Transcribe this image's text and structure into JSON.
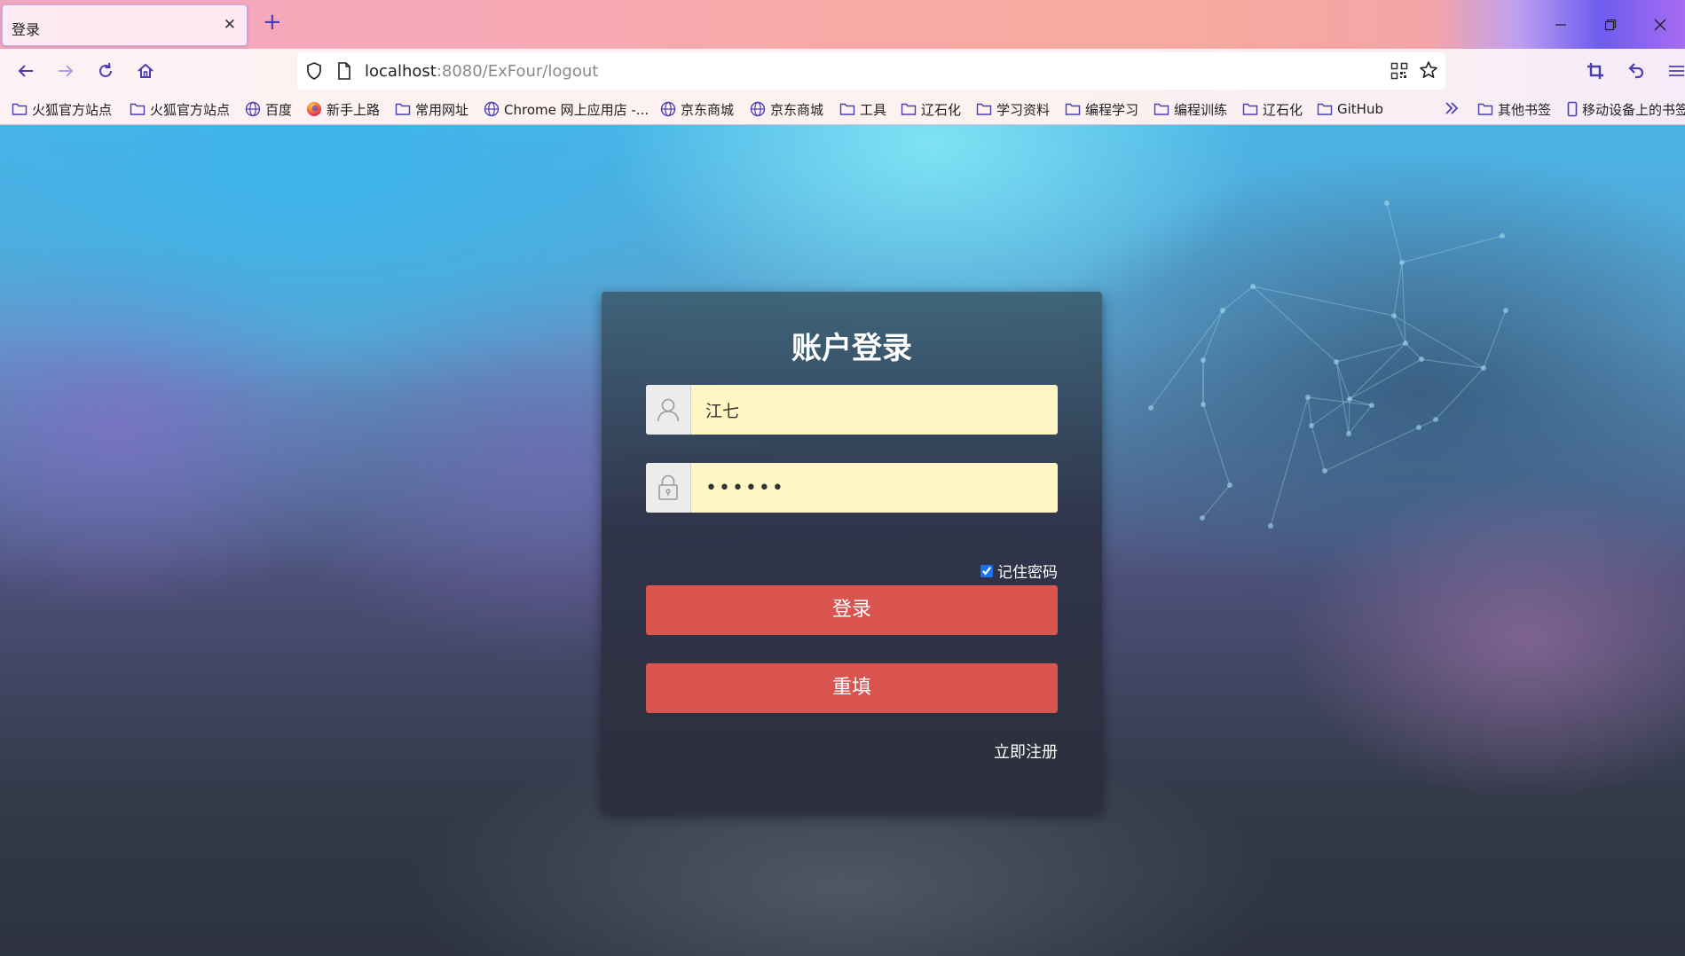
{
  "browser": {
    "tab": {
      "title": "登录"
    },
    "url": {
      "host": "localhost",
      "rest": ":8080/ExFour/logout"
    },
    "bookmarks": [
      {
        "label": "火狐官方站点",
        "icon": "folder-icon"
      },
      {
        "label": "火狐官方站点",
        "icon": "folder-icon"
      },
      {
        "label": "百度",
        "icon": "globe-icon"
      },
      {
        "label": "新手上路",
        "icon": "firefox-icon"
      },
      {
        "label": "常用网址",
        "icon": "folder-icon"
      },
      {
        "label": "Chrome 网上应用店 -...",
        "icon": "globe-icon"
      },
      {
        "label": "京东商城",
        "icon": "globe-icon"
      },
      {
        "label": "京东商城",
        "icon": "globe-icon"
      },
      {
        "label": "工具",
        "icon": "folder-icon"
      },
      {
        "label": "辽石化",
        "icon": "folder-icon"
      },
      {
        "label": "学习资料",
        "icon": "folder-icon"
      },
      {
        "label": "编程学习",
        "icon": "folder-icon"
      },
      {
        "label": "编程训练",
        "icon": "folder-icon"
      },
      {
        "label": "辽石化",
        "icon": "folder-icon"
      },
      {
        "label": "GitHub",
        "icon": "folder-icon"
      }
    ],
    "other_bookmarks": "其他书签",
    "mobile_bookmarks": "移动设备上的书签"
  },
  "login": {
    "title": "账户登录",
    "username": "江七",
    "password": "••••••",
    "remember_label": "记住密码",
    "remember_checked": true,
    "login_button": "登录",
    "reset_button": "重填",
    "register_link": "立即注册"
  },
  "colors": {
    "accent_button": "#d9534f",
    "input_bg": "#fff6c4",
    "browser_icon": "#4a3fb0"
  }
}
